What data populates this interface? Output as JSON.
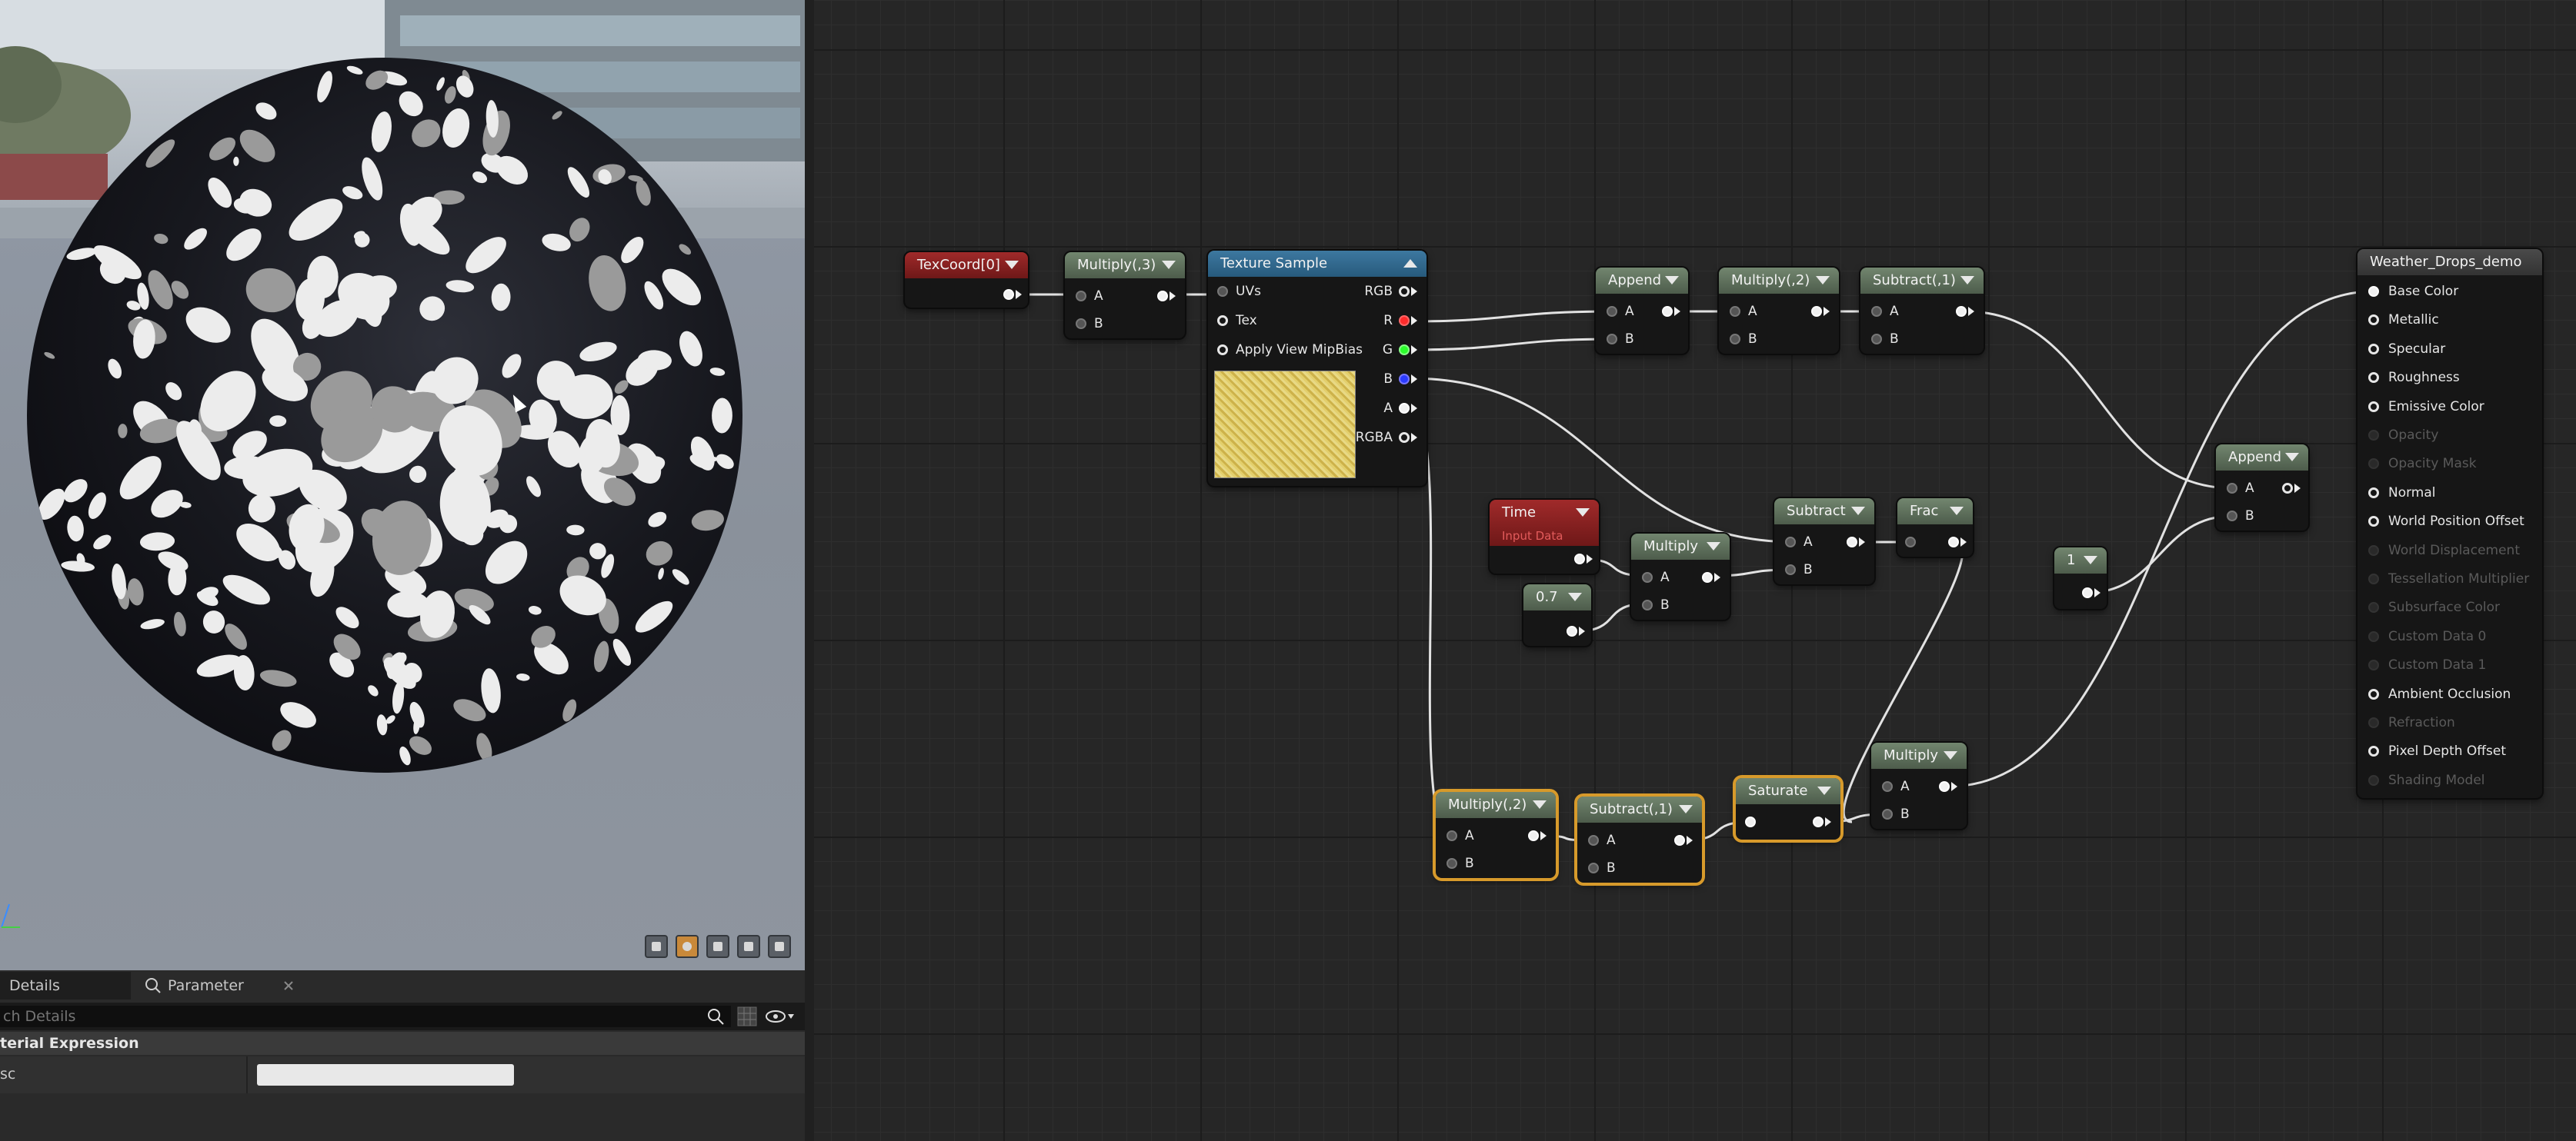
{
  "viewport": {
    "toolbar_icons": [
      "camera-icon",
      "sphere-preview-icon",
      "plane-preview-icon",
      "cube-preview-icon",
      "mesh-preview-icon"
    ],
    "colors": {
      "sphere": "#15161b",
      "drop": "#ececec",
      "drop_dim": "#9a9a9a"
    }
  },
  "details": {
    "tabs": [
      {
        "label": "Details"
      },
      {
        "label": "Parameter Defaults"
      }
    ],
    "search_placeholder": "ch Details",
    "section_title": "terial Expression",
    "desc_label": "sc"
  },
  "nodes": {
    "texcoord": {
      "title": "TexCoord[0]"
    },
    "multiply3": {
      "title": "Multiply(,3)",
      "pins": [
        "A",
        "B"
      ]
    },
    "texsample": {
      "title": "Texture Sample",
      "inputs": [
        "UVs",
        "Tex",
        "Apply View MipBias"
      ],
      "outputs": [
        "RGB",
        "R",
        "G",
        "B",
        "A",
        "RGBA"
      ]
    },
    "append1": {
      "title": "Append",
      "pins": [
        "A",
        "B"
      ]
    },
    "multiply2a": {
      "title": "Multiply(,2)",
      "pins": [
        "A",
        "B"
      ]
    },
    "subtract1a": {
      "title": "Subtract(,1)",
      "pins": [
        "A",
        "B"
      ]
    },
    "time": {
      "title": "Time",
      "subtitle": "Input Data"
    },
    "const07": {
      "title": "0.7"
    },
    "multiply_mid": {
      "title": "Multiply",
      "pins": [
        "A",
        "B"
      ]
    },
    "subtract_mid": {
      "title": "Subtract",
      "pins": [
        "A",
        "B"
      ]
    },
    "frac": {
      "title": "Frac"
    },
    "const1": {
      "title": "1"
    },
    "append2": {
      "title": "Append",
      "pins": [
        "A",
        "B"
      ]
    },
    "multiply2b": {
      "title": "Multiply(,2)",
      "pins": [
        "A",
        "B"
      ]
    },
    "subtract1b": {
      "title": "Subtract(,1)",
      "pins": [
        "A",
        "B"
      ]
    },
    "saturate": {
      "title": "Saturate"
    },
    "multiply_low": {
      "title": "Multiply",
      "pins": [
        "A",
        "B"
      ]
    },
    "material": {
      "title": "Weather_Drops_demo",
      "inputs": [
        {
          "label": "Base Color",
          "active": true
        },
        {
          "label": "Metallic",
          "active": true
        },
        {
          "label": "Specular",
          "active": true
        },
        {
          "label": "Roughness",
          "active": true
        },
        {
          "label": "Emissive Color",
          "active": true
        },
        {
          "label": "Opacity",
          "active": false
        },
        {
          "label": "Opacity Mask",
          "active": false
        },
        {
          "label": "Normal",
          "active": true
        },
        {
          "label": "World Position Offset",
          "active": true
        },
        {
          "label": "World Displacement",
          "active": false
        },
        {
          "label": "Tessellation Multiplier",
          "active": false
        },
        {
          "label": "Subsurface Color",
          "active": false
        },
        {
          "label": "Custom Data 0",
          "active": false
        },
        {
          "label": "Custom Data 1",
          "active": false
        },
        {
          "label": "Ambient Occlusion",
          "active": true
        },
        {
          "label": "Refraction",
          "active": false
        },
        {
          "label": "Pixel Depth Offset",
          "active": true
        },
        {
          "label": "Shading Model",
          "active": false
        }
      ]
    }
  },
  "colors": {
    "wire": "#e2e2e2",
    "selection": "#d79a2b",
    "texture_thumb": "#d9c25a"
  }
}
